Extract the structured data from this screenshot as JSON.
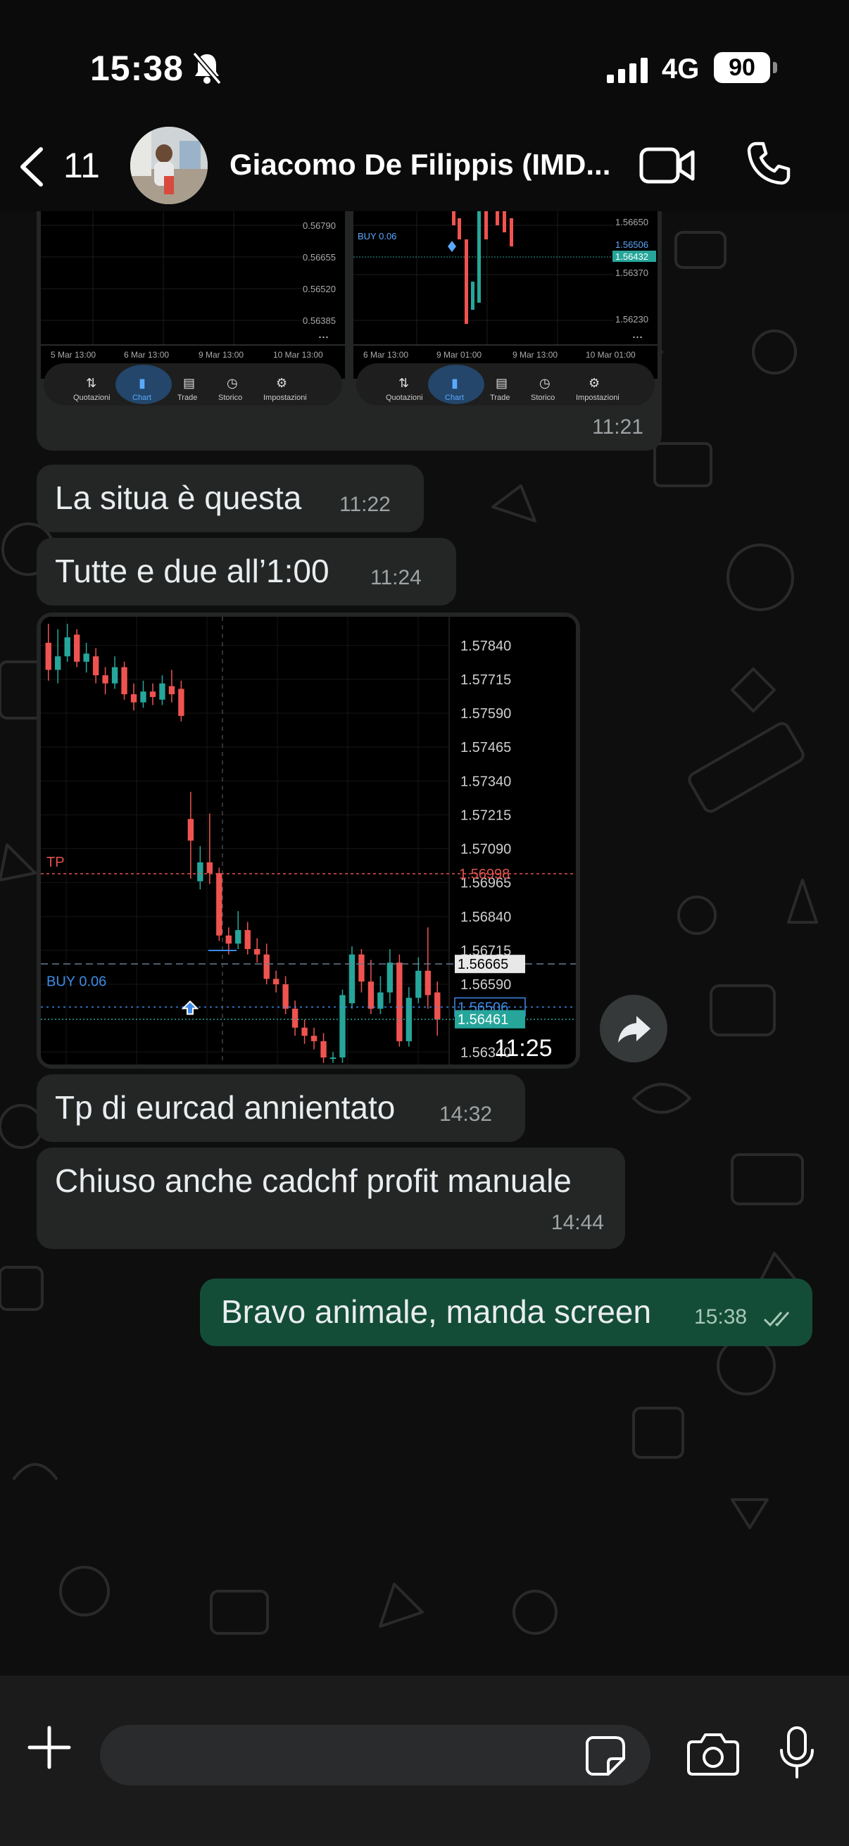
{
  "status_bar": {
    "time": "15:38",
    "network": "4G",
    "battery": "90"
  },
  "header": {
    "back_count": "11",
    "contact_name": "Giacomo De Filippis (IMD..."
  },
  "messages": [
    {
      "text": "La situa è questa",
      "time": "11:22"
    },
    {
      "text": "Tutte e due all’1:00",
      "time": "11:24"
    },
    {
      "text": "Tp di eurcad annientato",
      "time": "14:32"
    },
    {
      "text": "Chiuso anche cadchf profit manuale",
      "time": "14:44"
    }
  ],
  "outgoing_message": {
    "text": "Bravo animale, manda screen",
    "time": "15:38"
  },
  "top_image": {
    "time": "11:21",
    "left_chart": {
      "prices": [
        "0.56790",
        "0.56655",
        "0.56520",
        "0.56385"
      ],
      "dates": [
        "5 Mar 13:00",
        "6 Mar 13:00",
        "9 Mar 13:00",
        "10 Mar 13:00"
      ]
    },
    "right_chart": {
      "prices": [
        "1.56650",
        "1.56506",
        "1.56432",
        "1.56370",
        "1.56230"
      ],
      "dates": [
        "6 Mar 13:00",
        "9 Mar 01:00",
        "9 Mar 13:00",
        "10 Mar 01:00"
      ],
      "buy_label": "BUY 0.06"
    },
    "tabs": [
      "Quotazioni",
      "Chart",
      "Trade",
      "Storico",
      "Impostazioni"
    ],
    "more": "..."
  },
  "big_chart": {
    "time": "11:25",
    "tp_label": "TP",
    "buy_label": "BUY 0.06",
    "tp_price": "1.56998",
    "current_price": "1.56665",
    "buy_price": "1.56506",
    "bid_price": "1.56461",
    "colors": {
      "up": "#26a69a",
      "down": "#ef5350",
      "tp": "#e0534d",
      "buy": "#3d8be8"
    }
  },
  "chart_data": {
    "type": "candlestick",
    "y_ticks": [
      "1.57840",
      "1.57715",
      "1.57590",
      "1.57465",
      "1.57340",
      "1.57215",
      "1.57090",
      "1.56965",
      "1.56840",
      "1.56715",
      "1.56590",
      "1.56340"
    ],
    "ylim": [
      1.5632,
      1.5792
    ],
    "candles": [
      {
        "o": 1.5785,
        "c": 1.5775,
        "h": 1.5792,
        "l": 1.5771
      },
      {
        "o": 1.5775,
        "c": 1.578,
        "h": 1.579,
        "l": 1.577
      },
      {
        "o": 1.578,
        "c": 1.5787,
        "h": 1.5792,
        "l": 1.5778
      },
      {
        "o": 1.5788,
        "c": 1.5778,
        "h": 1.579,
        "l": 1.5776
      },
      {
        "o": 1.5778,
        "c": 1.5781,
        "h": 1.5785,
        "l": 1.5774
      },
      {
        "o": 1.578,
        "c": 1.5773,
        "h": 1.5783,
        "l": 1.577
      },
      {
        "o": 1.5773,
        "c": 1.577,
        "h": 1.5776,
        "l": 1.5766
      },
      {
        "o": 1.577,
        "c": 1.5776,
        "h": 1.578,
        "l": 1.5768
      },
      {
        "o": 1.5776,
        "c": 1.5766,
        "h": 1.5778,
        "l": 1.5764
      },
      {
        "o": 1.5766,
        "c": 1.5763,
        "h": 1.577,
        "l": 1.576
      },
      {
        "o": 1.5763,
        "c": 1.5767,
        "h": 1.5771,
        "l": 1.5761
      },
      {
        "o": 1.5767,
        "c": 1.5765,
        "h": 1.577,
        "l": 1.5762
      },
      {
        "o": 1.5764,
        "c": 1.577,
        "h": 1.5773,
        "l": 1.5762
      },
      {
        "o": 1.5769,
        "c": 1.5766,
        "h": 1.5775,
        "l": 1.5763
      },
      {
        "o": 1.5768,
        "c": 1.5758,
        "h": 1.5771,
        "l": 1.5756
      },
      {
        "o": 1.572,
        "c": 1.5712,
        "h": 1.573,
        "l": 1.5698
      },
      {
        "o": 1.5697,
        "c": 1.5704,
        "h": 1.571,
        "l": 1.5694
      },
      {
        "o": 1.5704,
        "c": 1.57,
        "h": 1.5722,
        "l": 1.5696
      },
      {
        "o": 1.57,
        "c": 1.5677,
        "h": 1.5702,
        "l": 1.5675
      },
      {
        "o": 1.5677,
        "c": 1.5674,
        "h": 1.568,
        "l": 1.567
      },
      {
        "o": 1.5674,
        "c": 1.5679,
        "h": 1.5686,
        "l": 1.5672
      },
      {
        "o": 1.5679,
        "c": 1.5672,
        "h": 1.5682,
        "l": 1.567
      },
      {
        "o": 1.5672,
        "c": 1.567,
        "h": 1.5676,
        "l": 1.5667
      },
      {
        "o": 1.567,
        "c": 1.5661,
        "h": 1.5674,
        "l": 1.5659
      },
      {
        "o": 1.5661,
        "c": 1.5659,
        "h": 1.5664,
        "l": 1.5656
      },
      {
        "o": 1.5659,
        "c": 1.565,
        "h": 1.5662,
        "l": 1.5648
      },
      {
        "o": 1.565,
        "c": 1.5643,
        "h": 1.5653,
        "l": 1.564
      },
      {
        "o": 1.5643,
        "c": 1.564,
        "h": 1.5646,
        "l": 1.5637
      },
      {
        "o": 1.564,
        "c": 1.5638,
        "h": 1.5643,
        "l": 1.5635
      },
      {
        "o": 1.5638,
        "c": 1.5632,
        "h": 1.5641,
        "l": 1.563
      },
      {
        "o": 1.5632,
        "c": 1.5632,
        "h": 1.5634,
        "l": 1.563
      },
      {
        "o": 1.5632,
        "c": 1.5655,
        "h": 1.5657,
        "l": 1.563
      },
      {
        "o": 1.5652,
        "c": 1.567,
        "h": 1.5673,
        "l": 1.565
      },
      {
        "o": 1.567,
        "c": 1.566,
        "h": 1.5672,
        "l": 1.5656
      },
      {
        "o": 1.566,
        "c": 1.565,
        "h": 1.5668,
        "l": 1.5648
      },
      {
        "o": 1.565,
        "c": 1.5656,
        "h": 1.5662,
        "l": 1.5648
      },
      {
        "o": 1.5656,
        "c": 1.5667,
        "h": 1.5672,
        "l": 1.5652
      },
      {
        "o": 1.5667,
        "c": 1.5638,
        "h": 1.567,
        "l": 1.5636
      },
      {
        "o": 1.5638,
        "c": 1.5654,
        "h": 1.5658,
        "l": 1.5636
      },
      {
        "o": 1.5654,
        "c": 1.5664,
        "h": 1.5669,
        "l": 1.5652
      },
      {
        "o": 1.5664,
        "c": 1.5655,
        "h": 1.568,
        "l": 1.565
      },
      {
        "o": 1.5656,
        "c": 1.5646,
        "h": 1.566,
        "l": 1.564
      }
    ]
  },
  "input_bar": {
    "placeholder": ""
  }
}
